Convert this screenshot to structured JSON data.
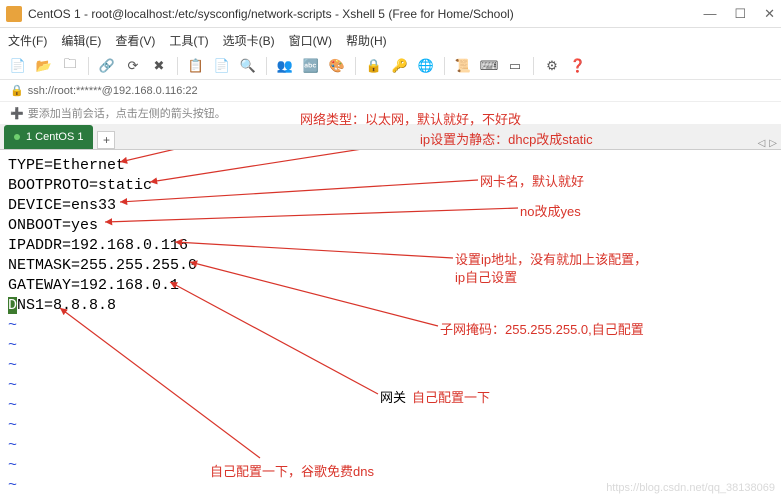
{
  "titlebar": {
    "text": "CentOS 1 - root@localhost:/etc/sysconfig/network-scripts - Xshell 5 (Free for Home/School)"
  },
  "winbtns": {
    "min": "—",
    "max": "☐",
    "close": "✕"
  },
  "menu": {
    "file": "文件(F)",
    "edit": "编辑(E)",
    "view": "查看(V)",
    "tools": "工具(T)",
    "tabs": "选项卡(B)",
    "window": "窗口(W)",
    "help": "帮助(H)"
  },
  "ssh": {
    "text": "ssh://root:******@192.168.0.116:22"
  },
  "hint": {
    "text": "要添加当前会话，点击左侧的箭头按钮。"
  },
  "tab": {
    "label": "1 CentOS 1"
  },
  "config": {
    "l1": "TYPE=Ethernet",
    "l2": "BOOTPROTO=static",
    "l3": "DEVICE=ens33",
    "l4": "ONBOOT=yes",
    "l5": "IPADDR=192.168.0.116",
    "l6": "NETMASK=255.255.255.0",
    "l7": "GATEWAY=192.168.0.1",
    "l8a": "D",
    "l8b": "NS1=8.8.8.8",
    "tilde": "~"
  },
  "annot": {
    "a1": "网络类型：以太网，默认就好，不好改",
    "a2": "ip设置为静态：dhcp改成static",
    "a3": "网卡名，默认就好",
    "a4": "no改成yes",
    "a5a": "设置ip地址，没有就加上该配置，",
    "a5b": "ip自己设置",
    "a6": "子网掩码：255.255.255.0,自己配置",
    "a7a": "网关",
    "a7b": "自己配置一下",
    "a8": "自己配置一下，谷歌免费dns"
  },
  "watermark": "https://blog.csdn.net/qq_38138069"
}
